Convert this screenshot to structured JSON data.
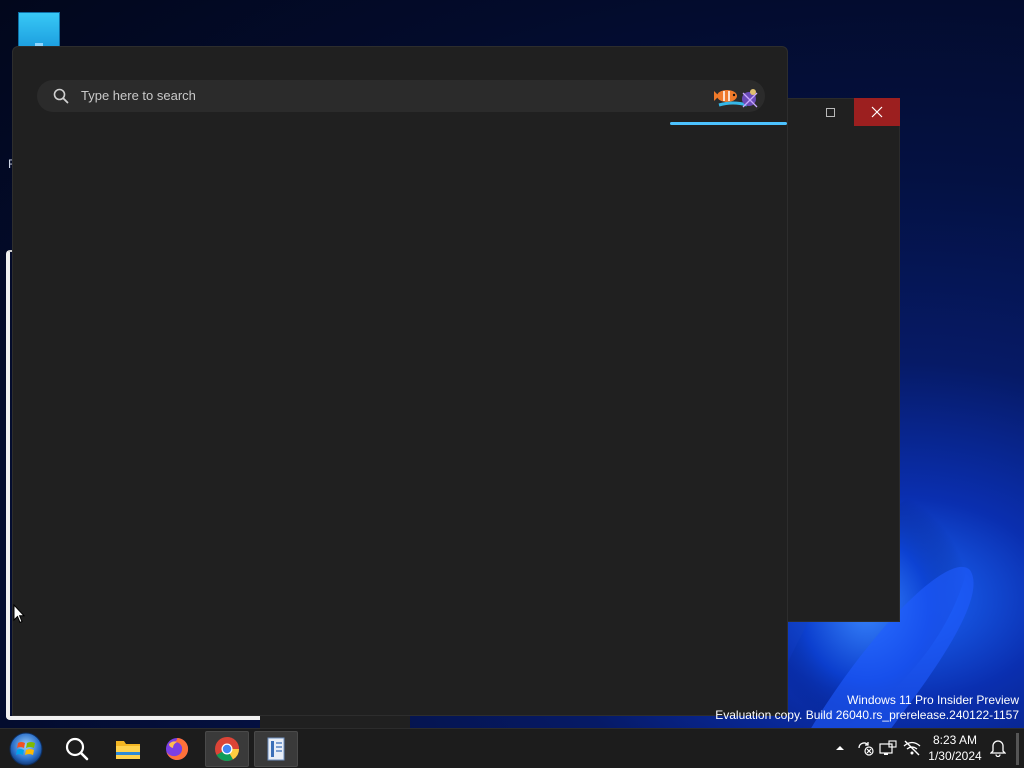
{
  "search": {
    "placeholder": "Type here to search",
    "progress_fraction": 0.39
  },
  "desktop": {
    "edge_letter": "F"
  },
  "watermark": {
    "line1": "Windows 11 Pro Insider Preview",
    "line2": "Evaluation copy. Build 26040.rs_prerelease.240122-1157"
  },
  "taskbar": {
    "items": [
      {
        "icon": "start-orb-icon"
      },
      {
        "icon": "search-icon"
      },
      {
        "icon": "file-explorer-icon"
      },
      {
        "icon": "firefox-icon"
      },
      {
        "icon": "chrome-icon"
      },
      {
        "icon": "app-window-icon"
      }
    ]
  },
  "clock": {
    "time": "8:23 AM",
    "date": "1/30/2024"
  },
  "colors": {
    "accent": "#4cc2ff",
    "panel": "#202020",
    "close": "#9c1f1f"
  }
}
